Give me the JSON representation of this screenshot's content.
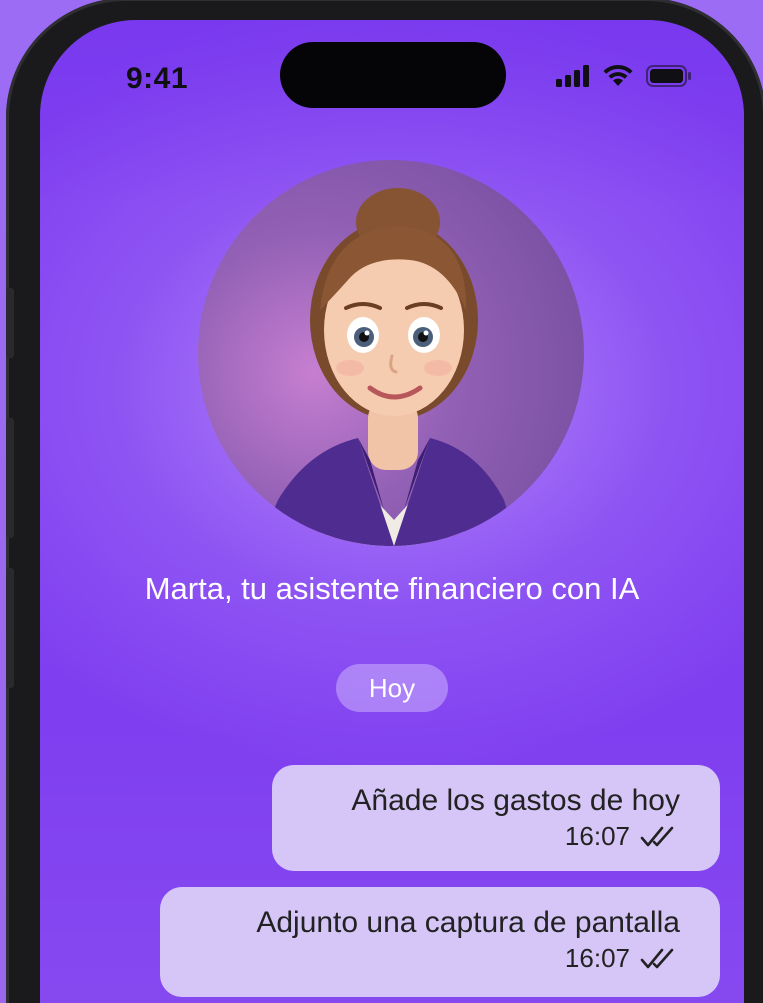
{
  "status_bar": {
    "time": "9:41",
    "icons": [
      "cellular-signal-icon",
      "wifi-icon",
      "battery-icon"
    ]
  },
  "assistant": {
    "avatar": "assistant-avatar-illustration",
    "title": "Marta, tu asistente financiero con IA"
  },
  "chat": {
    "day_label": "Hoy",
    "messages": [
      {
        "text": "Añade los gastos de hoy",
        "time": "16:07",
        "status_icon": "double-check-icon"
      },
      {
        "text": "Adjunto una captura de pantalla",
        "time": "16:07",
        "status_icon": "double-check-icon"
      }
    ]
  },
  "colors": {
    "background": "#9c6cf4",
    "screen_accent": "#8f55f3",
    "bubble": "#d6c6f8",
    "frame": "#1a1a1d"
  }
}
